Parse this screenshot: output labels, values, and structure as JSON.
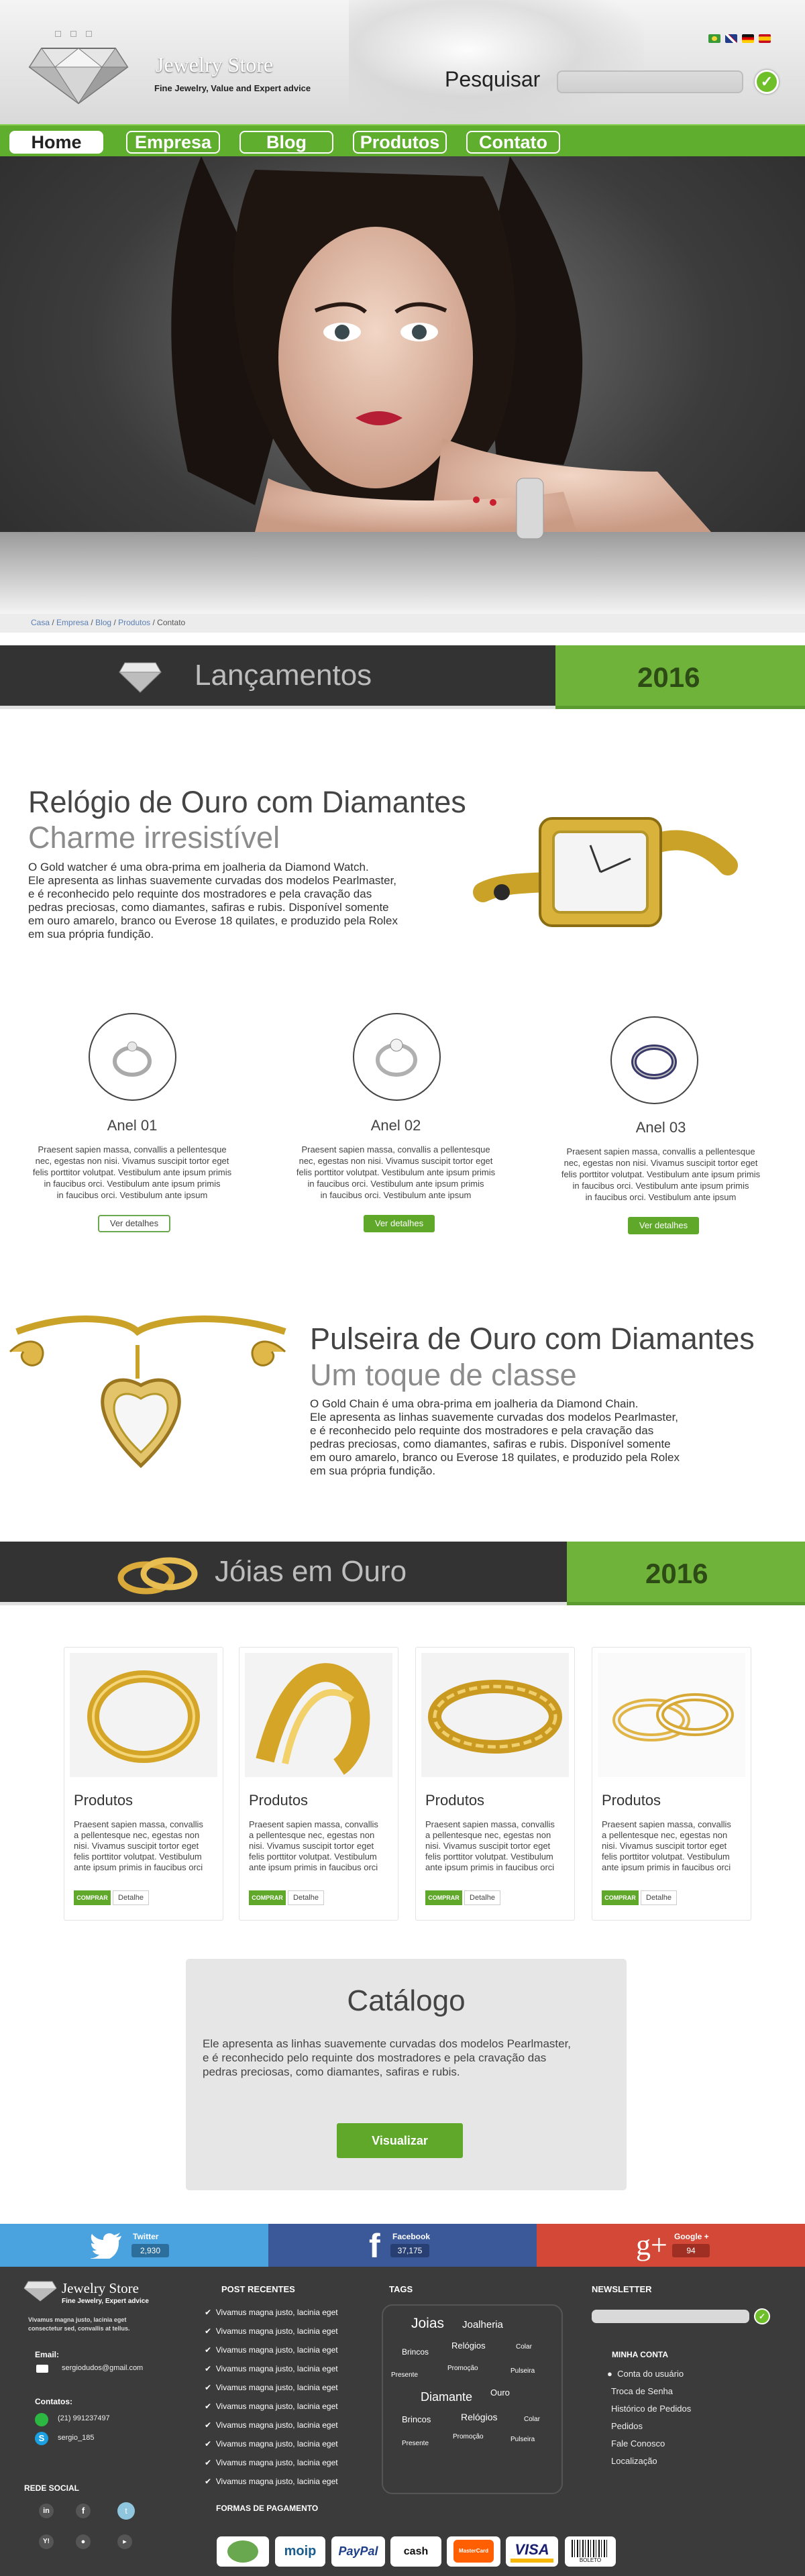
{
  "header": {
    "logo_title": "Jewelry Store",
    "logo_tagline": "Fine Jewelry, Value and Expert advice",
    "search_label": "Pesquisar",
    "search_placeholder": "",
    "languages": [
      "flag-brazil",
      "flag-uk",
      "flag-germany",
      "flag-spain"
    ]
  },
  "nav": {
    "items": [
      {
        "label": "Home"
      },
      {
        "label": "Empresa"
      },
      {
        "label": "Blog"
      },
      {
        "label": "Produtos"
      },
      {
        "label": "Contato"
      }
    ]
  },
  "breadcrumb": {
    "items": [
      "Casa",
      "Empresa",
      "Blog",
      "Produtos",
      "Contato"
    ]
  },
  "launches_bar": {
    "title": "Lançamentos",
    "year": "2016"
  },
  "watch_feature": {
    "title": "Relógio de Ouro com Diamantes",
    "subtitle": "Charme irresistível",
    "lines": [
      "O Gold watcher é uma obra-prima em joalheria da Diamond Watch.",
      "Ele apresenta as linhas suavemente curvadas dos modelos Pearlmaster,",
      " e é reconhecido pelo requinte dos mostradores e pela cravação das",
      "pedras preciosas, como diamantes, safiras e rubis. Disponível somente",
      "em ouro amarelo, branco ou Everose 18 quilates, e produzido pela Rolex",
      "em sua própria fundição."
    ]
  },
  "rings": [
    {
      "title": "Anel 01",
      "lines": [
        "Praesent sapien massa, convallis a pellentesque",
        "nec, egestas non nisi. Vivamus suscipit tortor eget",
        "felis porttitor volutpat. Vestibulum ante ipsum primis",
        "in faucibus orci. Vestibulum ante ipsum primis",
        "in faucibus orci. Vestibulum ante ipsum"
      ],
      "button": "Ver detalhes"
    },
    {
      "title": "Anel 02",
      "lines": [
        "Praesent sapien massa, convallis a pellentesque",
        "nec, egestas non nisi. Vivamus suscipit tortor eget",
        "felis porttitor volutpat. Vestibulum ante ipsum primis",
        "in faucibus orci. Vestibulum ante ipsum primis",
        "in faucibus orci. Vestibulum ante ipsum"
      ],
      "button": "Ver detalhes"
    },
    {
      "title": "Anel 03",
      "lines": [
        "Praesent sapien massa, convallis a pellentesque",
        "nec, egestas non nisi. Vivamus suscipit tortor eget",
        "felis porttitor volutpat. Vestibulum ante ipsum primis",
        "in faucibus orci. Vestibulum ante ipsum primis",
        "in faucibus orci. Vestibulum ante ipsum"
      ],
      "button": "Ver detalhes"
    }
  ],
  "bracelet_feature": {
    "title": "Pulseira de Ouro com Diamantes",
    "subtitle": "Um toque de classe",
    "lines": [
      "O Gold Chain é uma obra-prima em joalheria da Diamond Chain.",
      "Ele apresenta as linhas suavemente curvadas dos modelos Pearlmaster,",
      " e é reconhecido pelo requinte dos mostradores e pela cravação das",
      "pedras preciosas, como diamantes, safiras e rubis. Disponível somente",
      "em ouro amarelo, branco ou Everose 18 quilates, e produzido pela Rolex",
      "em sua própria fundição."
    ]
  },
  "gold_bar": {
    "title": "Jóias em Ouro",
    "year": "2016"
  },
  "products": [
    {
      "title": "Produtos",
      "lines": [
        "Praesent sapien massa, convallis",
        "a pellentesque nec, egestas non",
        "nisi. Vivamus suscipit tortor eget",
        "felis porttitor volutpat. Vestibulum",
        "ante ipsum primis in faucibus orci"
      ],
      "buy": "COMPRAR",
      "detail": "Detalhe"
    },
    {
      "title": "Produtos",
      "lines": [
        "Praesent sapien massa, convallis",
        "a pellentesque nec, egestas non",
        "nisi. Vivamus suscipit tortor eget",
        "felis porttitor volutpat. Vestibulum",
        "ante ipsum primis in faucibus orci"
      ],
      "buy": "COMPRAR",
      "detail": "Detalhe"
    },
    {
      "title": "Produtos",
      "lines": [
        "Praesent sapien massa, convallis",
        "a pellentesque nec, egestas non",
        "nisi. Vivamus suscipit tortor eget",
        "felis porttitor volutpat. Vestibulum",
        "ante ipsum primis in faucibus orci"
      ],
      "buy": "COMPRAR",
      "detail": "Detalhe"
    },
    {
      "title": "Produtos",
      "lines": [
        "Praesent sapien massa, convallis",
        "a pellentesque nec, egestas non",
        "nisi. Vivamus suscipit tortor eget",
        "felis porttitor volutpat. Vestibulum",
        "ante ipsum primis in faucibus orci"
      ],
      "buy": "COMPRAR",
      "detail": "Detalhe"
    }
  ],
  "catalog": {
    "title": "Catálogo",
    "lines": [
      "Ele apresenta as linhas suavemente curvadas dos modelos Pearlmaster,",
      " e é reconhecido pelo requinte dos mostradores e pela cravação das",
      "pedras preciosas, como diamantes, safiras e rubis."
    ],
    "button": "Visualizar"
  },
  "social": [
    {
      "name": "Twitter",
      "count": "2,930",
      "color": "#4aa3df"
    },
    {
      "name": "Facebook",
      "count": "37,175",
      "color": "#3b5998"
    },
    {
      "name": "Google +",
      "count": "94",
      "color": "#d34836"
    }
  ],
  "footer": {
    "logo_title": "Jewelry Store",
    "logo_tagline": "Fine Jewelry, Expert advice",
    "about": [
      "Vivamus magna justo, lacinia eget",
      "consectetur sed, convallis at tellus."
    ],
    "email_heading": "Email:",
    "email": "sergiodudos@gmail.com",
    "contacts_heading": "Contatos:",
    "phone": "(21) 991237497",
    "skype": "sergio_185",
    "social_heading": "REDE SOCIAL",
    "posts_heading": "POST RECENTES",
    "posts": [
      "Vivamus magna justo, lacinia eget",
      "Vivamus magna justo, lacinia eget",
      "Vivamus magna justo, lacinia eget",
      "Vivamus magna justo, lacinia eget",
      "Vivamus magna justo, lacinia eget",
      "Vivamus magna justo, lacinia eget",
      "Vivamus magna justo, lacinia eget",
      "Vivamus magna justo, lacinia eget",
      "Vivamus magna justo, lacinia eget",
      "Vivamus magna justo, lacinia eget"
    ],
    "tags_heading": "TAGS",
    "tags": [
      {
        "label": "Joias"
      },
      {
        "label": "Joalheria"
      },
      {
        "label": "Colar"
      },
      {
        "label": "Brincos"
      },
      {
        "label": "Relógios"
      },
      {
        "label": "Promoção"
      },
      {
        "label": "Pulseira"
      },
      {
        "label": "Presente"
      },
      {
        "label": "Ouro"
      },
      {
        "label": "Diamante"
      },
      {
        "label": "Brincos"
      },
      {
        "label": "Relógios"
      },
      {
        "label": "Colar"
      },
      {
        "label": "Promoção"
      },
      {
        "label": "Presente"
      },
      {
        "label": "Pulseira"
      }
    ],
    "newsletter_heading": "NEWSLETTER",
    "account_heading": "MINHA CONTA",
    "account_items": [
      "Conta do usuário",
      "Troca de Senha",
      "Histórico de Pedidos",
      "Pedidos",
      "Fale Conosco",
      "Localização"
    ],
    "payment_heading": "FORMAS DE PAGAMENTO",
    "payments": [
      "moip",
      "PayPal",
      "cash",
      "MasterCard",
      "VISA",
      "BOLETO"
    ]
  }
}
